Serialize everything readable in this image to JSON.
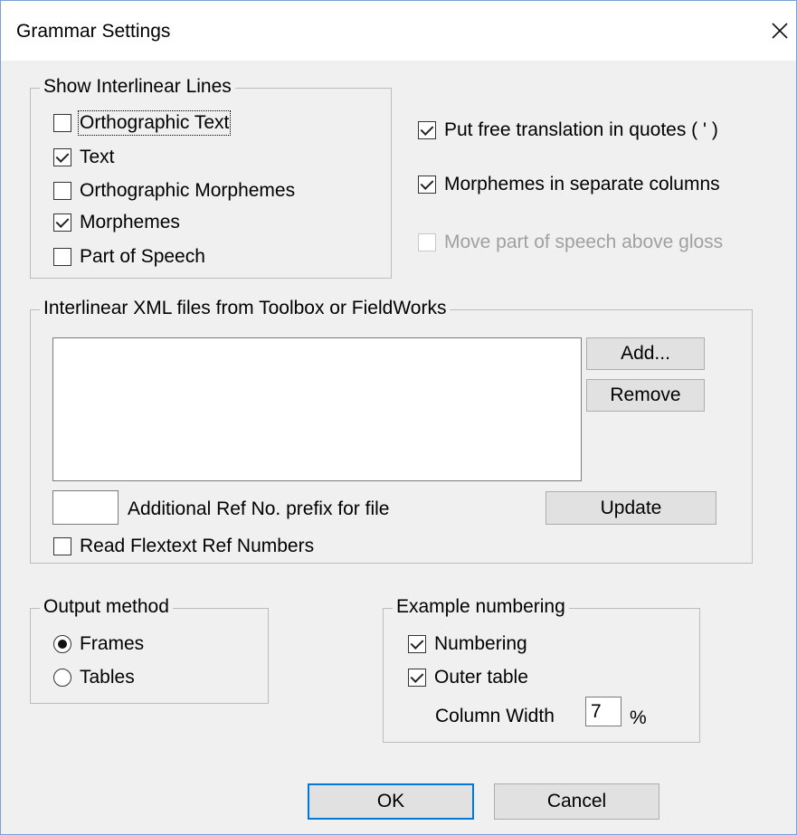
{
  "window": {
    "title": "Grammar Settings",
    "close_icon": "close-icon"
  },
  "interlinear_group": {
    "legend": "Show Interlinear Lines",
    "items": [
      {
        "label": "Orthographic Text",
        "checked": false
      },
      {
        "label": "Text",
        "checked": true
      },
      {
        "label": "Orthographic Morphemes",
        "checked": false
      },
      {
        "label": "Morphemes",
        "checked": true
      },
      {
        "label": "Part of Speech",
        "checked": false
      }
    ]
  },
  "options": [
    {
      "label": "Put free translation in quotes ( ' )",
      "checked": true,
      "enabled": true
    },
    {
      "label": "Morphemes in separate columns",
      "checked": true,
      "enabled": true
    },
    {
      "label": "Move part of speech above gloss",
      "checked": false,
      "enabled": false
    }
  ],
  "xml_group": {
    "legend": "Interlinear XML files from Toolbox or FieldWorks",
    "files": [],
    "add_label": "Add...",
    "remove_label": "Remove",
    "prefix_value": "",
    "prefix_label": "Additional Ref No. prefix for file",
    "update_label": "Update",
    "read_refs": {
      "label": "Read Flextext Ref Numbers",
      "checked": false
    }
  },
  "output_group": {
    "legend": "Output method",
    "options": [
      {
        "label": "Frames",
        "selected": true
      },
      {
        "label": "Tables",
        "selected": false
      }
    ]
  },
  "numbering_group": {
    "legend": "Example numbering",
    "numbering": {
      "label": "Numbering",
      "checked": true
    },
    "outer_table": {
      "label": "Outer table",
      "checked": true
    },
    "column_width_label": "Column Width",
    "column_width_value": "7",
    "percent": "%"
  },
  "buttons": {
    "ok": "OK",
    "cancel": "Cancel"
  }
}
